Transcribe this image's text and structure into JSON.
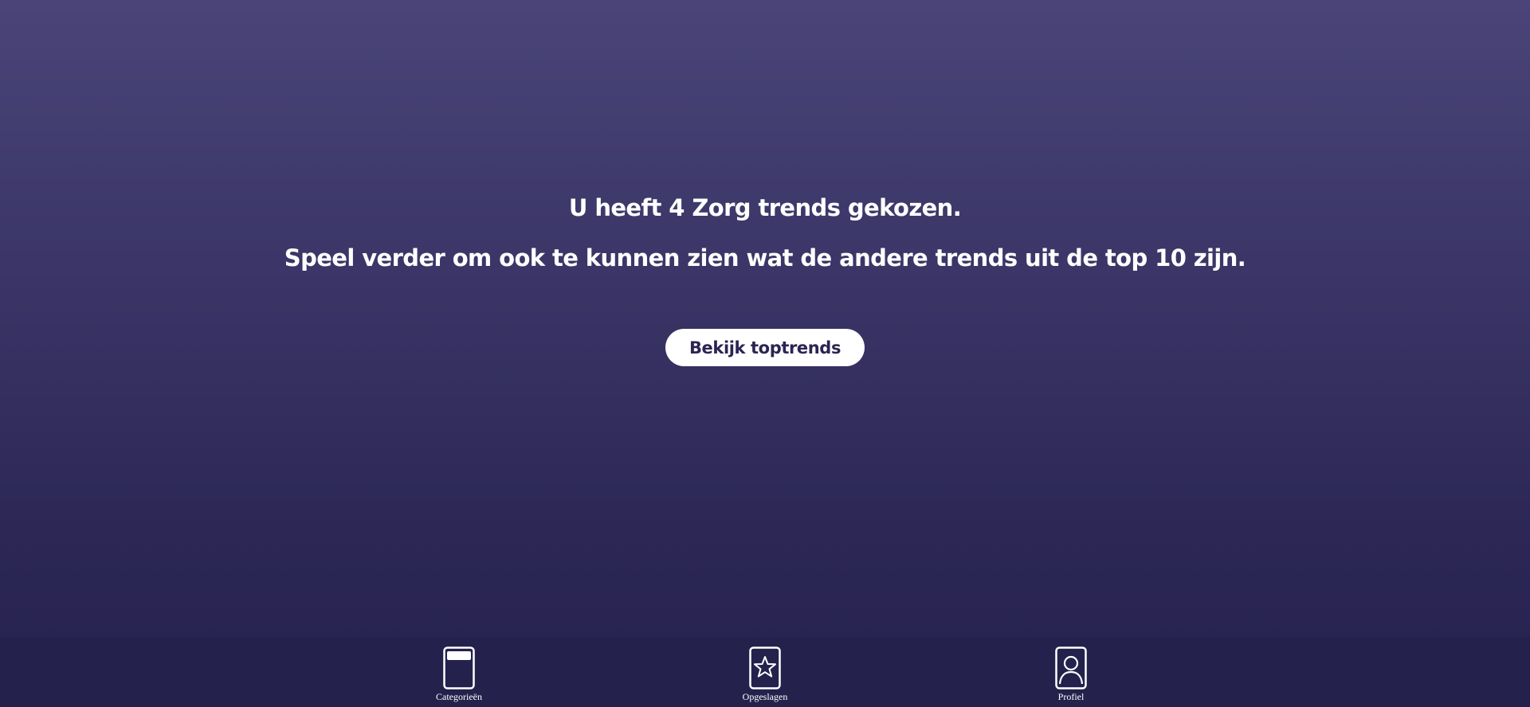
{
  "message": {
    "line1": "U heeft 4 Zorg trends gekozen.",
    "line2": "Speel verder om ook te kunnen zien wat de andere trends uit de top 10 zijn."
  },
  "cta": {
    "label": "Bekijk toptrends"
  },
  "nav": {
    "items": [
      {
        "label": "Categorieën",
        "icon": "card-icon"
      },
      {
        "label": "Opgeslagen",
        "icon": "star-icon"
      },
      {
        "label": "Profiel",
        "icon": "person-icon"
      }
    ]
  },
  "colors": {
    "background_top": "#4a4478",
    "background_bottom": "#262250",
    "nav_background": "#25214d",
    "button_background": "#ffffff",
    "button_text": "#2a2552"
  }
}
